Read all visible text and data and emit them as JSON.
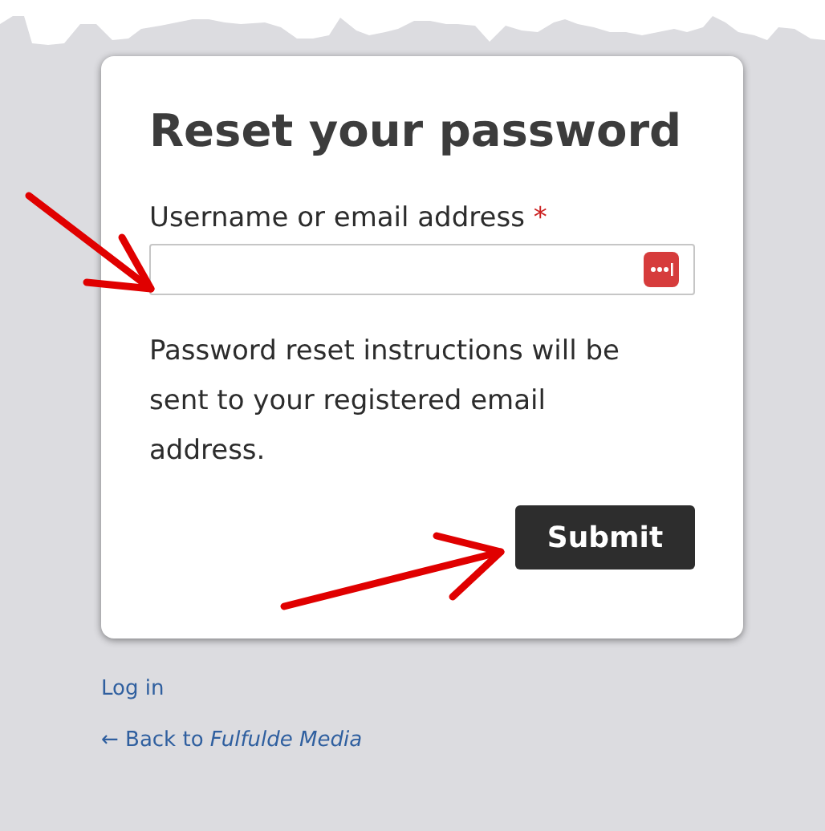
{
  "form": {
    "title": "Reset your password",
    "field": {
      "label": "Username or email address",
      "required_mark": "*",
      "required": true
    },
    "help_text": "Password reset instructions will be sent to your registered email address.",
    "submit_button": "Submit"
  },
  "links": [
    {
      "label": "Log in"
    },
    {
      "label": "← Back to *Fulfulde Media*"
    }
  ]
}
